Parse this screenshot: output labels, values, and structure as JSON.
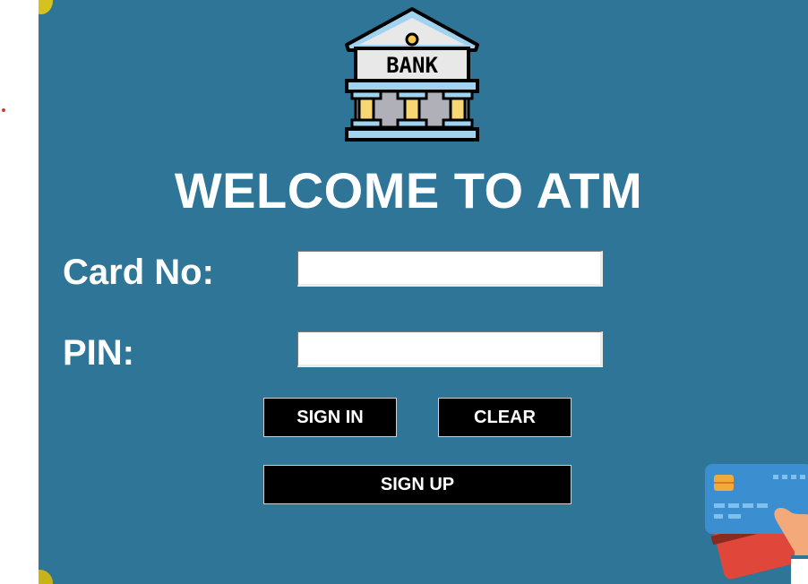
{
  "title": "WELCOME TO ATM",
  "logo": {
    "text": "BANK",
    "icon": "bank-building-icon"
  },
  "form": {
    "card_label": "Card No:",
    "card_value": "",
    "pin_label": "PIN:",
    "pin_value": ""
  },
  "buttons": {
    "sign_in": "SIGN IN",
    "clear": "CLEAR",
    "sign_up": "SIGN UP"
  },
  "decoration": {
    "cards_icon": "credit-cards-hand-icon"
  },
  "colors": {
    "background": "#2f7598",
    "text": "#ffffff",
    "button": "#000000"
  }
}
